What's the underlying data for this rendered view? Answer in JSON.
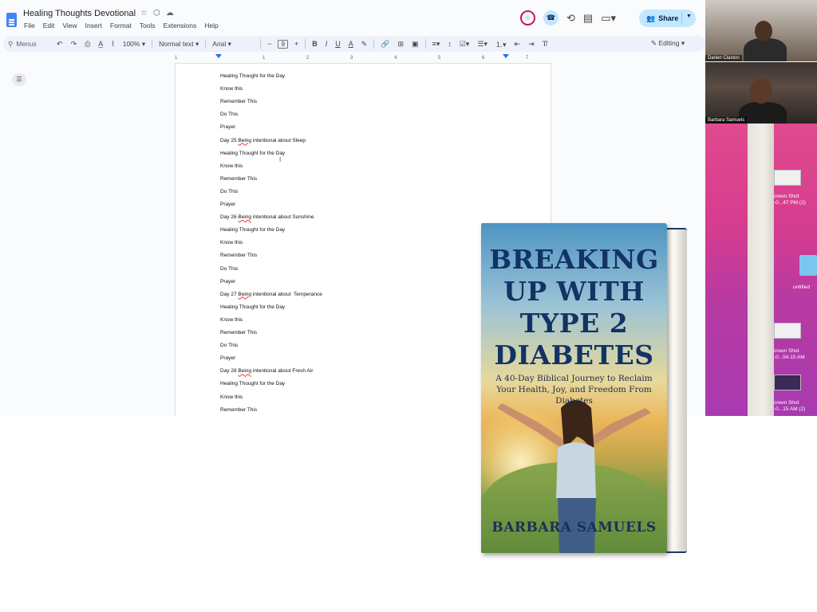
{
  "doc": {
    "title": "Healing Thoughts Devotional",
    "menu": [
      "File",
      "Edit",
      "View",
      "Insert",
      "Format",
      "Tools",
      "Extensions",
      "Help"
    ],
    "share_label": "Share"
  },
  "toolbar": {
    "search_placeholder": "Menus",
    "zoom": "100%",
    "style": "Normal text",
    "font": "Arial",
    "font_size": "9",
    "mode": "Editing"
  },
  "ruler": [
    "1",
    "1",
    "2",
    "3",
    "4",
    "5",
    "6",
    "7"
  ],
  "document_lines": [
    {
      "text": "Healing Thought for the Day"
    },
    {
      "text": "Know this"
    },
    {
      "text": "Remember This"
    },
    {
      "text": "Do This"
    },
    {
      "text": "Prayer"
    },
    {
      "pre": "Day 25 ",
      "sq": "Being",
      "post": " intentional about Sleep"
    },
    {
      "text": "Healing Thought for the Day"
    },
    {
      "text": "Know this"
    },
    {
      "text": "Remember This"
    },
    {
      "text": "Do This"
    },
    {
      "text": "Prayer"
    },
    {
      "pre": "Day 26 ",
      "sq": "Being",
      "post": " intentional about Sunshine"
    },
    {
      "text": "Healing Thought for the Day"
    },
    {
      "text": "Know this"
    },
    {
      "text": "Remember This"
    },
    {
      "text": "Do This"
    },
    {
      "text": "Prayer"
    },
    {
      "pre": "Day 27 ",
      "sq": "Being",
      "post": " intentional about  Temperance"
    },
    {
      "text": "Healing Thought for the Day"
    },
    {
      "text": "Know this"
    },
    {
      "text": "Remember This"
    },
    {
      "text": "Do This"
    },
    {
      "text": "Prayer"
    },
    {
      "pre": "Day 28 ",
      "sq": "Being",
      "post": " intentional about Fresh Air"
    },
    {
      "text": "Healing Thought for the Day"
    },
    {
      "text": "Know this"
    },
    {
      "text": "Remember This"
    }
  ],
  "participants": [
    "Darien Claxton",
    "Barbara Samuels"
  ],
  "desktop": {
    "items": [
      {
        "label_1": "creen Shot",
        "label_2": "-0...47 PM (2)"
      },
      {
        "label_1": "untitled",
        "label_2": ""
      },
      {
        "label_1": "creen Shot",
        "label_2": "-0...54.15 AM"
      },
      {
        "label_1": "creen Shot",
        "label_2": "-0...15 AM (2)"
      }
    ]
  },
  "book": {
    "title_lines": [
      "BREAKING",
      "UP WITH",
      "TYPE 2",
      "DIABETES"
    ],
    "subtitle_lines": [
      "A 40-Day Biblical Journey to Reclaim",
      "Your Health, Joy, and Freedom From Diabetes"
    ],
    "author": "BARBARA SAMUELS"
  },
  "colors": {
    "accent": "#1a73e8",
    "share_bg": "#c2e7ff",
    "book_title": "#123363"
  }
}
